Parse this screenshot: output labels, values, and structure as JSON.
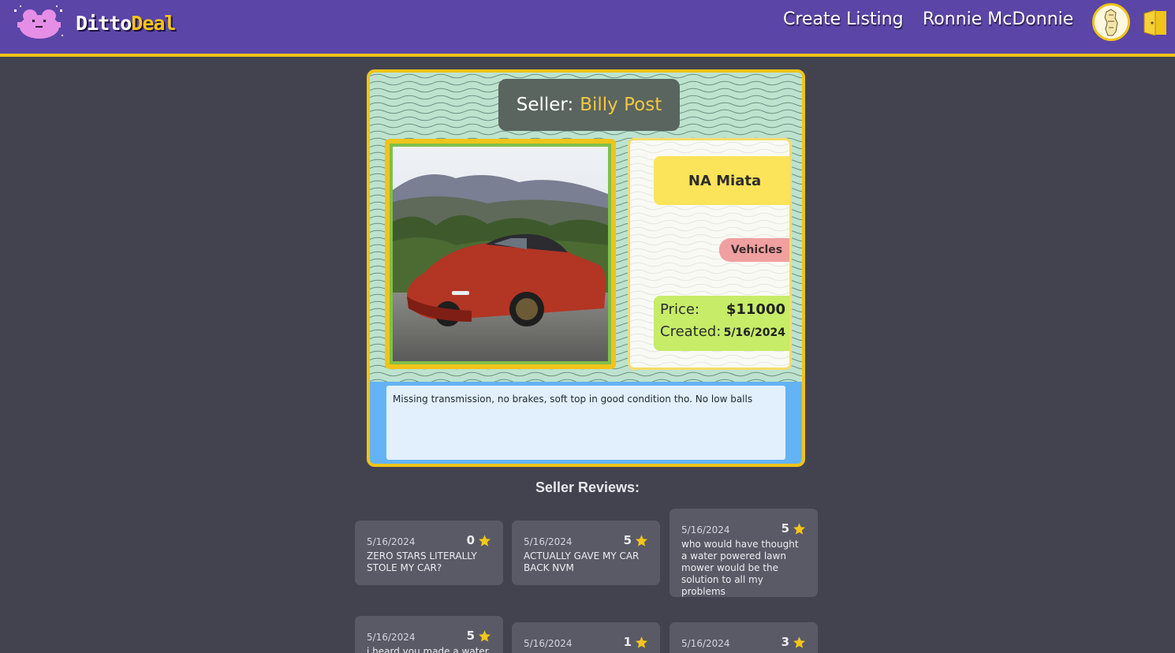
{
  "header": {
    "brand_part1": "Ditto",
    "brand_part2": "Deal",
    "create_listing": "Create Listing",
    "user_name": "Ronnie McDonnie"
  },
  "listing": {
    "seller_label": "Seller:",
    "seller_name": "Billy Post",
    "title": "NA Miata",
    "category": "Vehicles",
    "price_label": "Price:",
    "price": "$11000",
    "created_label": "Created:",
    "created": "5/16/2024",
    "description": "Missing transmission, no brakes, soft top in good condition tho. No low balls"
  },
  "reviews": {
    "title": "Seller Reviews:",
    "items": [
      {
        "date": "5/16/2024",
        "rating": "0",
        "text": "ZERO STARS LITERALLY STOLE MY CAR?"
      },
      {
        "date": "5/16/2024",
        "rating": "5",
        "text": "ACTUALLY GAVE MY CAR BACK NVM"
      },
      {
        "date": "5/16/2024",
        "rating": "5",
        "text": "who would have thought a water powered lawn mower would be the solution to all my problems"
      },
      {
        "date": "5/16/2024",
        "rating": "5",
        "text": "i heard you made a water"
      },
      {
        "date": "5/16/2024",
        "rating": "1",
        "text": ""
      },
      {
        "date": "5/16/2024",
        "rating": "3",
        "text": ""
      }
    ]
  },
  "colors": {
    "header_bg": "#5b45a7",
    "accent_yellow": "#f0c419",
    "page_bg": "#43434f",
    "star": "#f5c518"
  }
}
